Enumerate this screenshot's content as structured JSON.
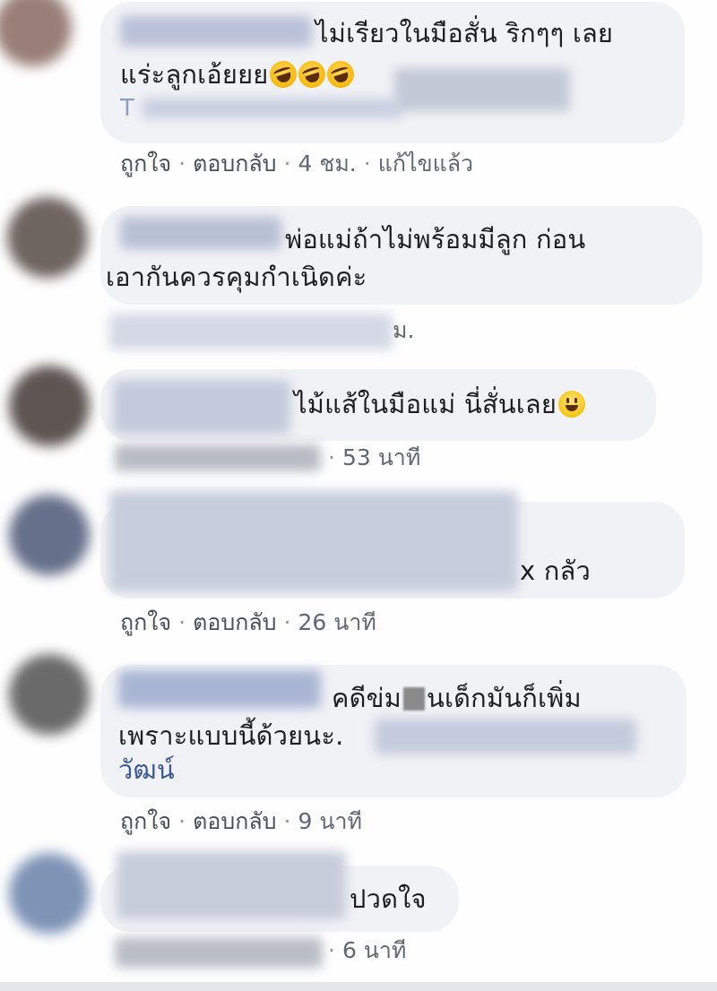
{
  "comments": [
    {
      "lines": [
        "ไม่เรียวในมือสั่น ริกๆๆ เลย",
        "แร่ะลูกเอ้ยยย"
      ],
      "emoji": [
        "rolling-on-floor-laughing-icon",
        "rolling-on-floor-laughing-icon",
        "rolling-on-floor-laughing-icon"
      ],
      "partial": "T",
      "actions": {
        "like": "ถูกใจ",
        "reply": "ตอบกลับ",
        "time": "4 ชม.",
        "edited": "แก้ไขแล้ว"
      }
    },
    {
      "lines": [
        "พ่อแม่ถ้าไม่พร้อมมีลูก ก่อน",
        "เอากันควรคุมกำเนิดค่ะ"
      ],
      "meta_partial": "ม."
    },
    {
      "lines": [
        "ไม้แส้ในมือแม่ นี่สั่นเลย"
      ],
      "emoji": [
        "smiling-face-icon"
      ],
      "actions": {
        "time": "53 นาที"
      }
    },
    {
      "lines": [
        "x กลัว"
      ],
      "actions": {
        "like": "ถูกใจ",
        "reply": "ตอบกลับ",
        "time": "26 นาที"
      }
    },
    {
      "lines": [
        "คดีข่ม",
        "นเด็กมันก็เพิ่ม",
        "เพราะแบบนี้ด้วยนะ.",
        "วัฒน์"
      ],
      "actions": {
        "like": "ถูกใจ",
        "reply": "ตอบกลับ",
        "time": "9 นาที"
      }
    },
    {
      "lines": [
        "ปวดใจ"
      ],
      "actions": {
        "time": "6 นาที"
      }
    }
  ],
  "separator": "·",
  "colors": {
    "bubble": "#f1f2f5",
    "text": "#1c1e21",
    "meta": "#626770",
    "link": "#385898"
  }
}
